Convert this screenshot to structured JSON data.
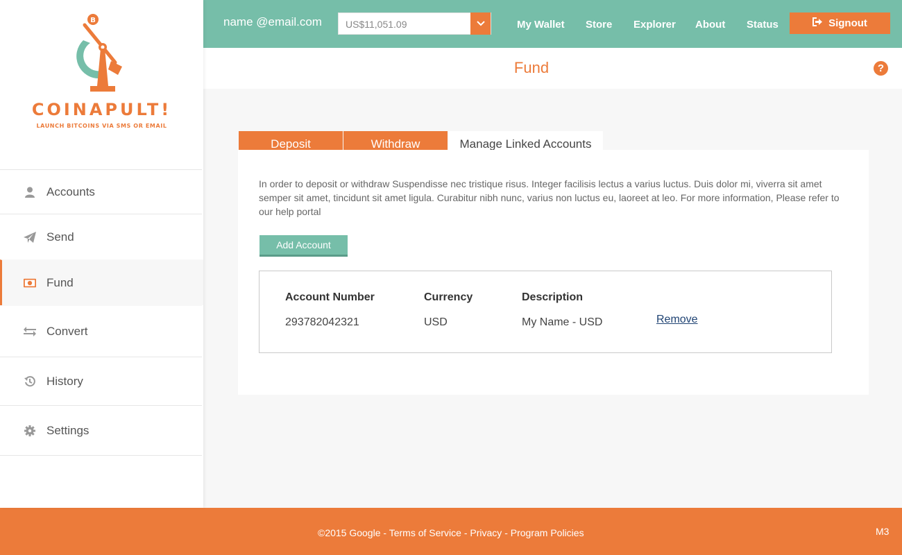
{
  "brand": {
    "name": "COINAPULT!",
    "tagline": "LAUNCH BITCOINS VIA SMS OR EMAIL",
    "accent": "#ec7b3a",
    "secondary": "#76bea9"
  },
  "sidebar": {
    "items": [
      {
        "label": "Accounts",
        "icon": "user-icon",
        "active": false
      },
      {
        "label": "Send",
        "icon": "paper-plane-icon",
        "active": false
      },
      {
        "label": "Fund",
        "icon": "money-bill-icon",
        "active": true
      },
      {
        "label": "Convert",
        "icon": "exchange-arrows-icon",
        "active": false
      },
      {
        "label": "History",
        "icon": "history-icon",
        "active": false
      },
      {
        "label": "Settings",
        "icon": "gear-icon",
        "active": false
      }
    ]
  },
  "header": {
    "email": "name @email.com",
    "balance": "US$11,051.09",
    "nav": [
      "My Wallet",
      "Store",
      "Explorer",
      "About",
      "Status"
    ],
    "signout_label": "Signout"
  },
  "page": {
    "title": "Fund",
    "tabs": [
      "Deposit",
      "Withdraw",
      "Manage Linked Accounts"
    ],
    "active_tab": "Manage Linked Accounts",
    "intro": "In order to deposit or withdraw Suspendisse nec tristique risus. Integer facilisis lectus a varius luctus. Duis dolor mi, viverra sit amet semper sit amet, tincidunt sit amet ligula. Curabitur nibh nunc, varius non luctus eu, laoreet at leo. For more information, Please refer to our help portal",
    "add_account_label": "Add Account",
    "table": {
      "headers": [
        "Account Number",
        "Currency",
        "Description"
      ],
      "rows": [
        {
          "account_number": "293782042321",
          "currency": "USD",
          "description": "My Name - USD",
          "action": "Remove"
        }
      ]
    }
  },
  "footer": {
    "copyright": "©2015 Google",
    "links": [
      "Terms of Service",
      "Privacy",
      "Program Policies"
    ],
    "separator": " - ",
    "code": "M3"
  }
}
